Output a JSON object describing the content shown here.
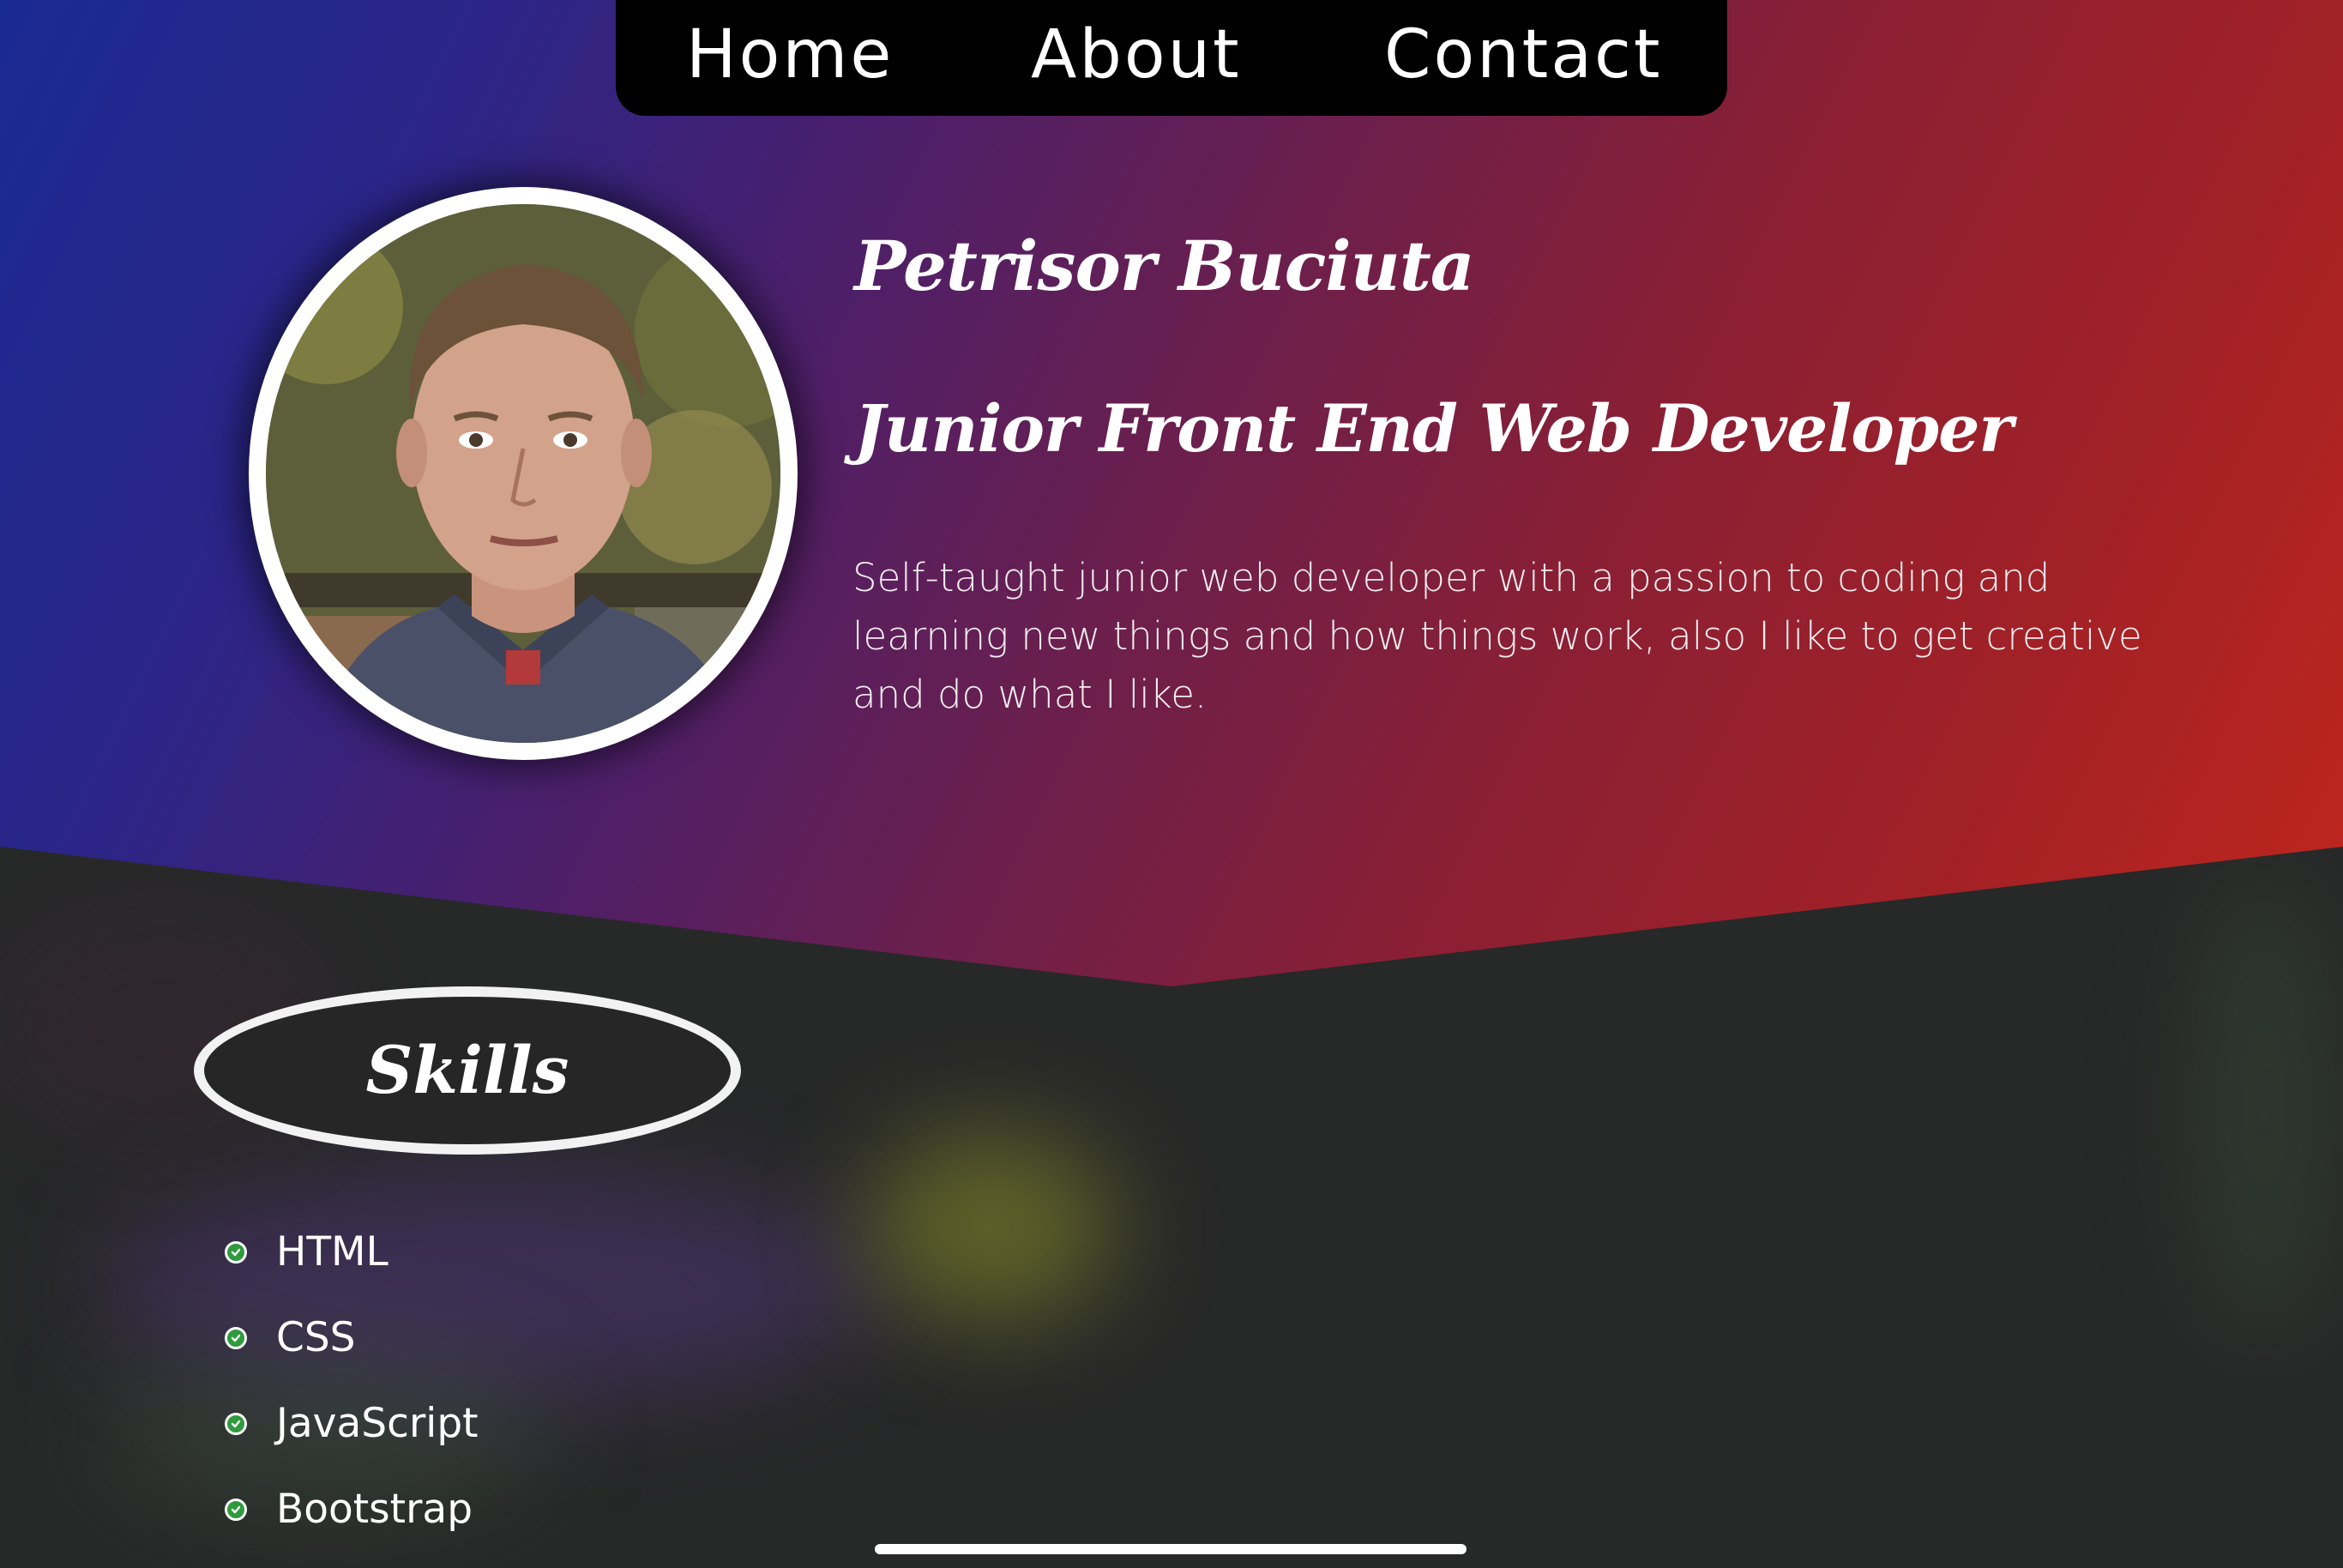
{
  "nav": {
    "links": [
      {
        "label": "Home"
      },
      {
        "label": "About"
      },
      {
        "label": "Contact"
      }
    ]
  },
  "profile": {
    "name": "Petrisor Buciuta",
    "role": "Junior Front End Web Developer",
    "bio": "Self-taught junior web developer with a passion to coding and learning new things and how things work, also I like to get creative and do what I like.",
    "avatar_icon": "profile-photo"
  },
  "skills": {
    "title": "Skills",
    "items": [
      {
        "label": "HTML",
        "icon": "check-circle-icon"
      },
      {
        "label": "CSS",
        "icon": "check-circle-icon"
      },
      {
        "label": "JavaScript",
        "icon": "check-circle-icon"
      },
      {
        "label": "Bootstrap",
        "icon": "check-circle-icon"
      }
    ]
  },
  "colors": {
    "gradient_start": "#1a2a93",
    "gradient_mid": "#6c1f4c",
    "gradient_end": "#c0261d",
    "nav_background": "#000000",
    "dark_background": "#272828",
    "check_green": "#2f9a3e"
  }
}
